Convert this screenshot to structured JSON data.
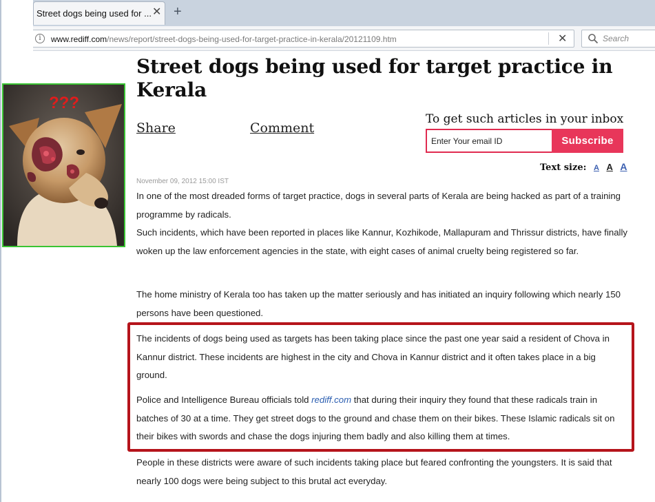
{
  "browser": {
    "tab_title": "Street dogs being used for ...",
    "tab_close": "✕",
    "new_tab": "+",
    "url_host": "www.rediff.com",
    "url_path": "/news/report/street-dogs-being-used-for-target-practice-in-kerala/20121109.htm",
    "url_clear": "✕",
    "search_placeholder": "Search"
  },
  "article": {
    "headline": "Street dogs being used for target practice in Kerala",
    "share_label": "Share",
    "comment_label": "Comment",
    "date": "November 09, 2012 15:00 IST",
    "paragraph_1": "In one of the most dreaded forms of target practice, dogs in several parts of Kerala are being hacked as part of a training programme by radicals.",
    "paragraph_2": "Such incidents, which have been reported in places like Kannur, Kozhikode, Mallapuram and Thrissur districts, have finally woken up the law enforcement agencies in the state, with eight cases of animal cruelty being registered so far.",
    "paragraph_3": "The home ministry of Kerala too has taken up the matter seriously and has initiated an inquiry following which nearly 150 persons have been questioned.",
    "paragraph_4": "The incidents of dogs being used as targets has been taking place since the past one year said a resident of Chova in Kannur district. These incidents are highest in the city and Chova in Kannur district and it often takes place in a big ground.",
    "paragraph_5_before": "Police and Intelligence Bureau officials told ",
    "paragraph_5_link": "rediff.com",
    "paragraph_5_after": " that during their inquiry they found that these radicals train in batches of 30 at a time. They get street dogs to the ground and chase them on their bikes. These Islamic radicals sit on their bikes with swords and chase the dogs injuring them badly and also killing them at times.",
    "paragraph_6": "People in these districts were aware of such incidents taking place but feared confronting the youngsters. It is said that nearly 100 dogs were being subject to this brutal act everyday."
  },
  "newsletter": {
    "title": "To get such articles in your inbox",
    "email_placeholder": "Enter Your email ID",
    "subscribe_label": "Subscribe"
  },
  "text_size": {
    "label": "Text size:",
    "small": "A",
    "medium": "A",
    "large": "A"
  },
  "photo": {
    "overlay_text": "???"
  },
  "colors": {
    "highlight_border": "#b5141b",
    "photo_border": "#39c432",
    "subscribe_bg": "#e8365a",
    "link": "#2a5db0"
  }
}
